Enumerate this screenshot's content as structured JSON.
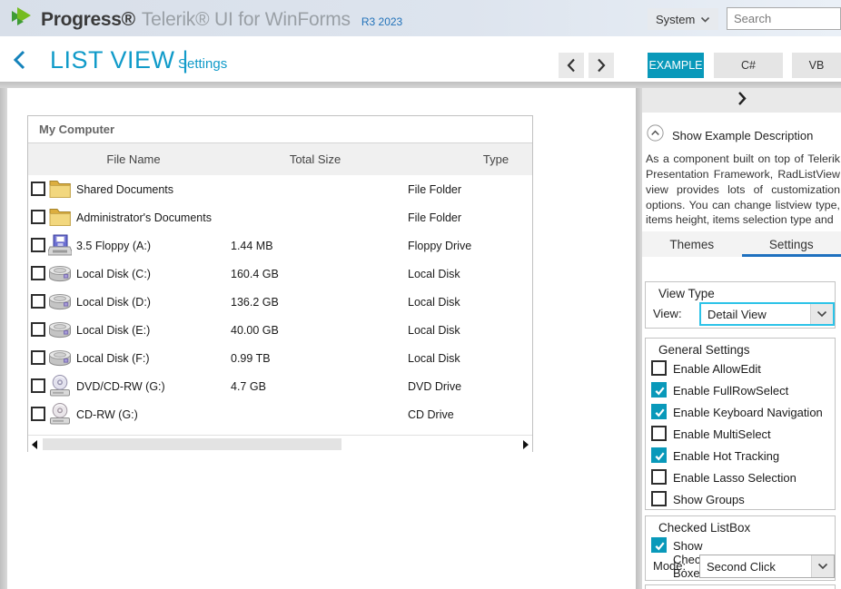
{
  "colors": {
    "accent-teal": "#0999ba",
    "title-cyan": "#119bc9",
    "back-blue": "#1583bb",
    "version-blue": "#2272b9",
    "tab-underline-blue": "#1e70bf",
    "dropdown-highlight-cyan": "#2cc3e8",
    "logo-green-dark": "#3f9c35",
    "logo-green-light": "#76bc21"
  },
  "header": {
    "brand": "Progress®",
    "product": "Telerik® UI for WinForms",
    "version": "R3 2023",
    "theme_selected": "System",
    "search_placeholder": "Search"
  },
  "title_bar": {
    "title": "LIST VIEW |",
    "subtitle": "Settings"
  },
  "code_tabs": [
    {
      "label": "EXAMPLE",
      "active": true
    },
    {
      "label": "C#",
      "active": false
    },
    {
      "label": "VB",
      "active": false
    }
  ],
  "description": {
    "toggle_label": "Show Example Description",
    "text": "As a component built on top of Telerik Presentation Framework, RadListView view provides lots of customization options. You can change listview type, items height, items selection type and"
  },
  "panel_tabs": [
    {
      "label": "Themes",
      "active": false
    },
    {
      "label": "Settings",
      "active": true
    }
  ],
  "view_type": {
    "title": "View Type",
    "label": "View:",
    "value": "Detail View"
  },
  "general_settings": {
    "title": "General Settings",
    "options": [
      {
        "label": "Enable AllowEdit",
        "checked": false
      },
      {
        "label": "Enable FullRowSelect",
        "checked": true
      },
      {
        "label": "Enable Keyboard Navigation",
        "checked": true
      },
      {
        "label": "Enable MultiSelect",
        "checked": false
      },
      {
        "label": "Enable Hot Tracking",
        "checked": true
      },
      {
        "label": "Enable Lasso Selection",
        "checked": false
      },
      {
        "label": "Show Groups",
        "checked": false
      }
    ]
  },
  "checked_listbox": {
    "title": "Checked ListBox",
    "checkbox": {
      "label": "Show Check Boxes",
      "checked": true
    },
    "mode_label": "Mode:",
    "mode_value": "Second Click"
  },
  "listview": {
    "title": "My Computer",
    "columns": [
      "File Name",
      "Total Size",
      "Type"
    ],
    "rows": [
      {
        "icon": "folder",
        "name": "Shared Documents",
        "size": "",
        "type": "File Folder",
        "checked": false
      },
      {
        "icon": "folder",
        "name": "Administrator's Documents",
        "size": "",
        "type": "File Folder",
        "checked": false
      },
      {
        "icon": "floppy",
        "name": "3.5 Floppy (A:)",
        "size": "1.44 MB",
        "type": "Floppy Drive",
        "checked": false
      },
      {
        "icon": "disk",
        "name": "Local Disk (C:)",
        "size": "160.4 GB",
        "type": "Local Disk",
        "checked": false
      },
      {
        "icon": "disk",
        "name": "Local Disk (D:)",
        "size": "136.2 GB",
        "type": "Local Disk",
        "checked": false
      },
      {
        "icon": "disk",
        "name": "Local Disk (E:)",
        "size": "40.00 GB",
        "type": "Local Disk",
        "checked": false
      },
      {
        "icon": "disk",
        "name": "Local Disk (F:)",
        "size": "0.99 TB",
        "type": "Local Disk",
        "checked": false
      },
      {
        "icon": "dvd",
        "name": "DVD/CD-RW (G:)",
        "size": "4.7 GB",
        "type": "DVD Drive",
        "checked": false
      },
      {
        "icon": "cd",
        "name": "CD-RW (G:)",
        "size": "",
        "type": "CD Drive",
        "checked": false
      }
    ]
  }
}
